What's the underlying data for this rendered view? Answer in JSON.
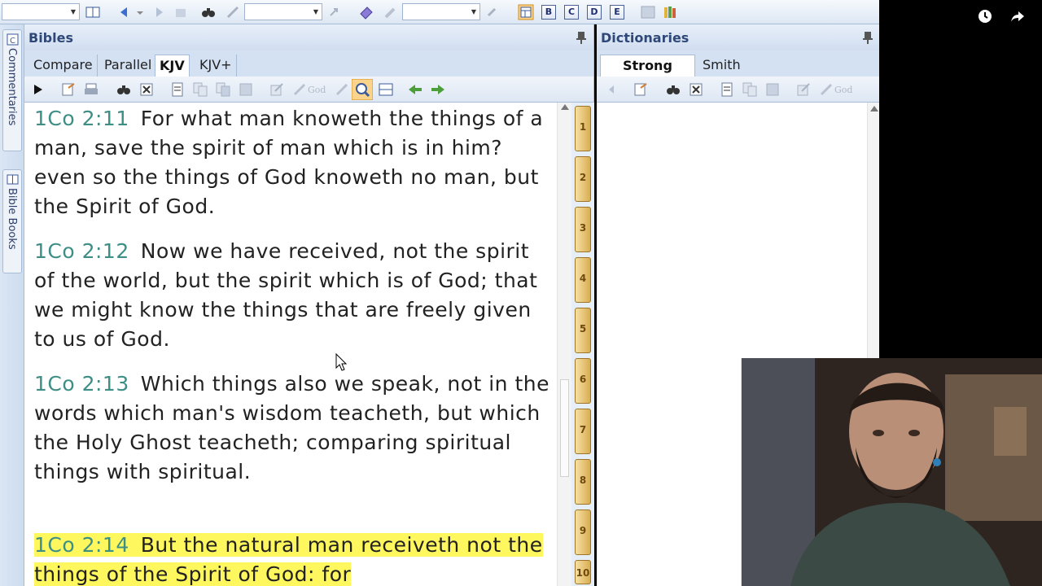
{
  "toolbar": {
    "letter_buttons": [
      "B",
      "C",
      "D",
      "E"
    ]
  },
  "side_tabs": {
    "commentaries": "Commentaries",
    "bible_books": "Bible Books"
  },
  "bibles": {
    "title": "Bibles",
    "tabs": [
      "Compare",
      "Parallel",
      "KJV",
      "KJV+"
    ],
    "active_tab": "KJV",
    "verses": [
      {
        "ref": "1Co 2:11",
        "text": "For what man knoweth the things of a man, save the spirit of man which is in him? even so the things of God knoweth no man, but the Spirit of God.",
        "highlighted": false
      },
      {
        "ref": "1Co 2:12",
        "text": "Now we have received, not the spirit of the world, but the spirit which is of God; that we might know the things that are freely given to us of God.",
        "highlighted": false
      },
      {
        "ref": "1Co 2:13",
        "text": "Which things also we speak, not in the words which man's wisdom teacheth, but which the Holy Ghost teacheth; comparing spiritual things with spiritual.",
        "highlighted": false
      },
      {
        "ref": "1Co 2:14",
        "text": "But the natural man receiveth not the things of the Spirit of God: for",
        "highlighted": true
      }
    ],
    "book_tabs": [
      "1",
      "2",
      "3",
      "4",
      "5",
      "6",
      "7",
      "8",
      "9",
      "10"
    ]
  },
  "dictionaries": {
    "title": "Dictionaries",
    "tabs": [
      "Strong",
      "Smith"
    ],
    "active_tab": "Strong"
  },
  "colors": {
    "verse_ref": "#3d8f86",
    "highlight": "#fff75e",
    "pane_title": "#2f4878"
  },
  "icons": {
    "video_overlay": [
      "clock-icon",
      "share-icon"
    ]
  }
}
